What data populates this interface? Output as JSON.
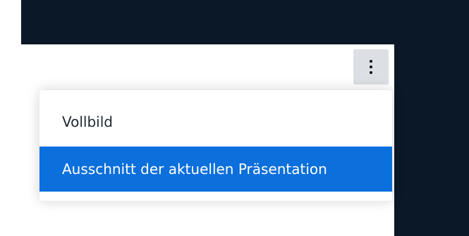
{
  "toolbar": {
    "menu_button_icon": "kebab-icon"
  },
  "menu": {
    "items": [
      {
        "label": "Vollbild",
        "selected": false
      },
      {
        "label": "Ausschnitt der aktuellen Präsentation",
        "selected": true
      }
    ]
  },
  "colors": {
    "dark_background": "#0b1827",
    "menu_highlight": "#0b6fdc",
    "button_background": "#dcdfe3"
  }
}
